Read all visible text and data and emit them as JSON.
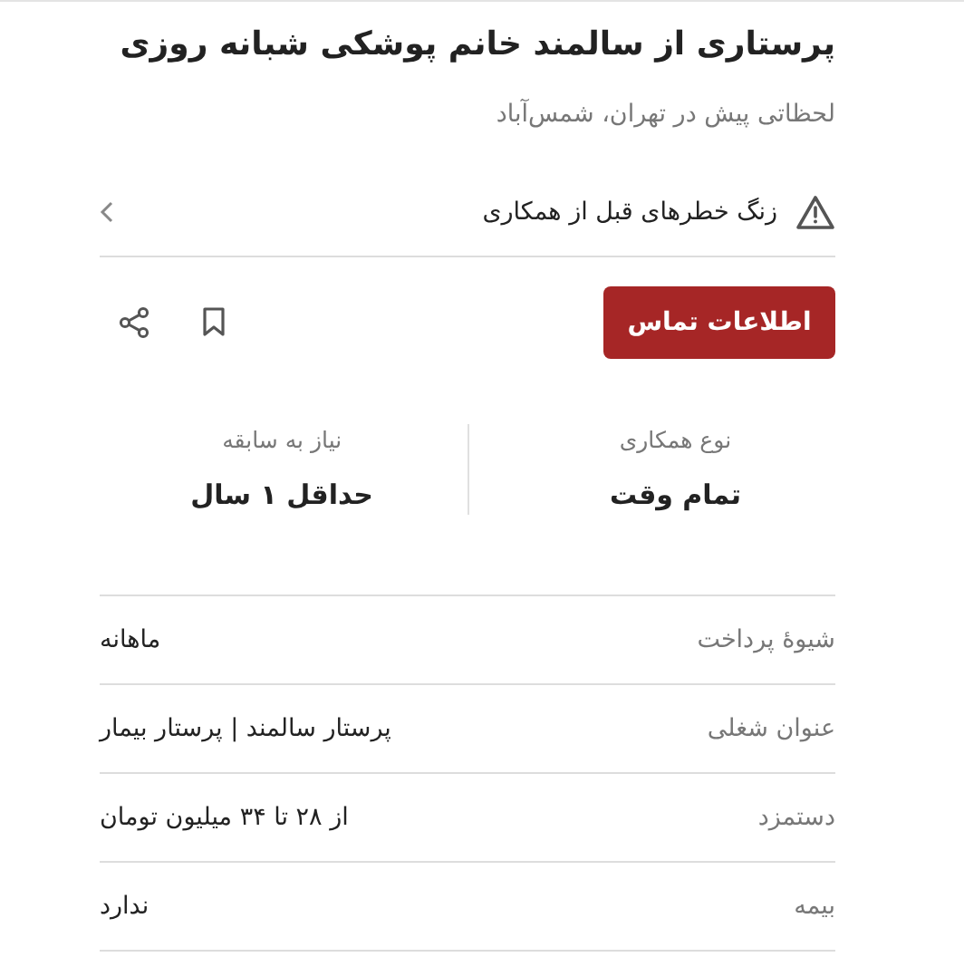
{
  "title": "پرستاری از سالمند خانم پوشکی شبانه روزی",
  "subtitle": "لحظاتی پیش در تهران، شمس‌آباد",
  "warning": {
    "label": "زنگ خطرهای قبل از همکاری"
  },
  "contact_button": "اطلاعات تماس",
  "stats": [
    {
      "label": "نوع همکاری",
      "value": "تمام وقت"
    },
    {
      "label": "نیاز به سابقه",
      "value": "حداقل ۱ سال"
    }
  ],
  "details": [
    {
      "label": "شیوهٔ پرداخت",
      "value": "ماهانه"
    },
    {
      "label": "عنوان شغلی",
      "value": "پرستار سالمند | پرستار بیمار"
    },
    {
      "label": "دستمزد",
      "value": "از ۲۸ تا ۳۴ میلیون تومان"
    },
    {
      "label": "بیمه",
      "value": "ندارد"
    }
  ]
}
